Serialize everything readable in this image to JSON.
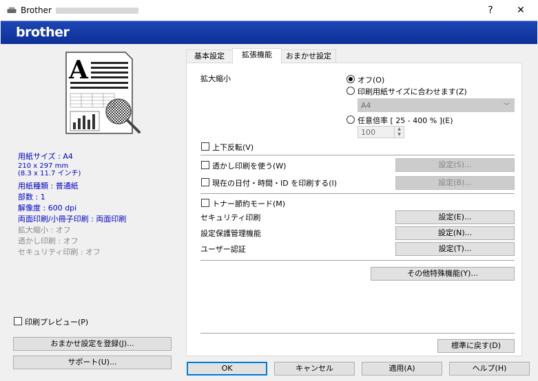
{
  "window": {
    "title": "Brother",
    "help_glyph": "?",
    "close_glyph": "✕"
  },
  "banner": {
    "logo_text": "brother"
  },
  "left": {
    "paper_size_label": "用紙サイズ : A4",
    "paper_dims_mm": "210 x 297 mm",
    "paper_dims_in": "(8.3 x 11.7 インチ)",
    "media_type": "用紙種類 : 普通紙",
    "copies": "部数 : 1",
    "resolution": "解像度 : 600 dpi",
    "duplex": "両面印刷/小冊子印刷 : 両面印刷",
    "scaling": "拡大縮小 : オフ",
    "watermark": "透かし印刷 : オフ",
    "secure": "セキュリティ印刷 : オフ",
    "print_preview_label": "印刷プレビュー(P)",
    "print_preview_checked": false,
    "register_shortcut_label": "おまかせ設定を登録(J)...",
    "support_label": "サポート(U)..."
  },
  "tabs": [
    {
      "label": "基本設定",
      "active": false
    },
    {
      "label": "拡張機能",
      "active": true
    },
    {
      "label": "おまかせ設定",
      "active": false
    }
  ],
  "advanced": {
    "scaling_label": "拡大縮小",
    "scaling_options": [
      {
        "label": "オフ(O)",
        "selected": true
      },
      {
        "label": "印刷用紙サイズに合わせます(Z)",
        "selected": false
      },
      {
        "label": "任意倍率 [ 25 - 400 % ](E)",
        "selected": false
      }
    ],
    "fit_paper_value": "A4",
    "free_scale_value": "100",
    "reverse_print_label": "上下反転(V)",
    "reverse_print_checked": false,
    "watermark_label": "透かし印刷を使う(W)",
    "watermark_checked": false,
    "watermark_settings": "設定(S)...",
    "header_footer_label": "現在の日付・時間・ID を印刷する(I)",
    "header_footer_checked": false,
    "header_footer_settings": "設定(B)...",
    "toner_save_label": "トナー節約モード(M)",
    "toner_save_checked": false,
    "secure_print_label": "セキュリティ印刷",
    "secure_print_settings": "設定(E)...",
    "admin_label": "設定保護管理機能",
    "admin_settings": "設定(N)...",
    "user_auth_label": "ユーザー認証",
    "user_auth_settings": "設定(T)...",
    "other_print_options": "その他特殊機能(Y)...",
    "default_label": "標準に戻す(D)"
  },
  "footer": {
    "ok": "OK",
    "cancel": "キャンセル",
    "apply": "適用(A)",
    "help": "ヘルプ(H)"
  }
}
